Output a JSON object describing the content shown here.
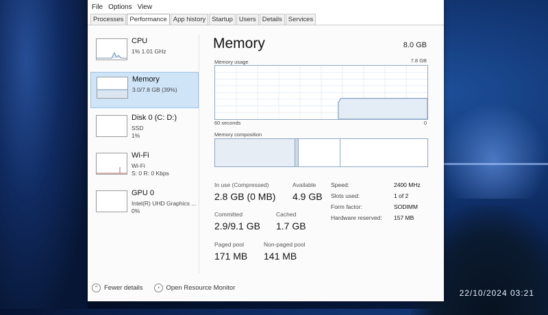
{
  "menu": [
    "File",
    "Options",
    "View"
  ],
  "tabs": [
    {
      "label": "Processes",
      "active": false
    },
    {
      "label": "Performance",
      "active": true
    },
    {
      "label": "App history",
      "active": false
    },
    {
      "label": "Startup",
      "active": false
    },
    {
      "label": "Users",
      "active": false
    },
    {
      "label": "Details",
      "active": false
    },
    {
      "label": "Services",
      "active": false
    }
  ],
  "sidebar": {
    "items": [
      {
        "name": "CPU",
        "sub": "1% 1.01 GHz",
        "sub2": "",
        "selected": false
      },
      {
        "name": "Memory",
        "sub": "3.0/7.8 GB (39%)",
        "sub2": "",
        "selected": true
      },
      {
        "name": "Disk 0 (C: D:)",
        "sub": "SSD",
        "sub2": "1%",
        "selected": false
      },
      {
        "name": "Wi-Fi",
        "sub": "Wi-Fi",
        "sub2": "S: 0 R: 0 Kbps",
        "selected": false
      },
      {
        "name": "GPU 0",
        "sub": "Intel(R) UHD Graphics ...",
        "sub2": "0%",
        "selected": false
      }
    ]
  },
  "main": {
    "title": "Memory",
    "total": "8.0 GB",
    "usage_label": "Memory usage",
    "usage_max": "7.8 GB",
    "time_left": "60 seconds",
    "time_right": "0",
    "composition_label": "Memory composition",
    "usage_fraction_now": 0.39
  },
  "stats": {
    "in_use_label": "In use (Compressed)",
    "in_use_value": "2.8 GB (0 MB)",
    "available_label": "Available",
    "available_value": "4.9 GB",
    "committed_label": "Committed",
    "committed_value": "2.9/9.1 GB",
    "cached_label": "Cached",
    "cached_value": "1.7 GB",
    "paged_label": "Paged pool",
    "paged_value": "171 MB",
    "nonpaged_label": "Non-paged pool",
    "nonpaged_value": "141 MB"
  },
  "specs": [
    {
      "label": "Speed:",
      "value": "2400 MHz"
    },
    {
      "label": "Slots used:",
      "value": "1 of 2"
    },
    {
      "label": "Form factor:",
      "value": "SODIMM"
    },
    {
      "label": "Hardware reserved:",
      "value": "157 MB"
    }
  ],
  "footer": {
    "fewer_details": "Fewer details",
    "open_monitor": "Open Resource Monitor"
  },
  "clock": "22/10/2024 03:21",
  "colors": {
    "accent": "#8fa8c4",
    "selection": "#cfe4f7",
    "graph_fill": "#e4ecf5"
  }
}
